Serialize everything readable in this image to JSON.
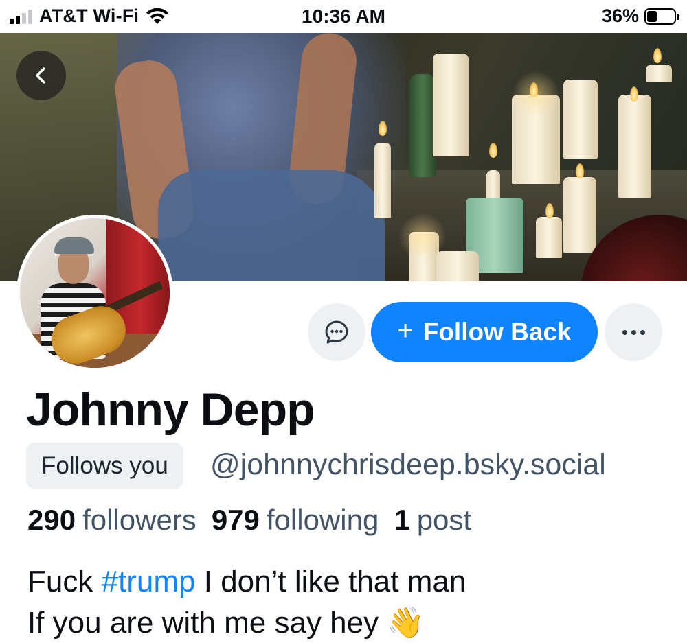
{
  "status_bar": {
    "carrier": "AT&T Wi-Fi",
    "time": "10:36 AM",
    "battery_percent": "36%"
  },
  "profile": {
    "display_name": "Johnny Depp",
    "follows_you_label": "Follows you",
    "handle": "@johnnychrisdeep.bsky.social",
    "followers_count": "290",
    "followers_label": "followers",
    "following_count": "979",
    "following_label": "following",
    "posts_count": "1",
    "posts_label": "post",
    "bio_line1_prefix": "Fuck ",
    "bio_hashtag": "#trump",
    "bio_line1_suffix": " I don’t like that man",
    "bio_line2": "If you are with me say hey",
    "bio_emoji": "👋"
  },
  "actions": {
    "follow_back_label": "Follow Back",
    "follow_plus": "+"
  },
  "colors": {
    "accent": "#1083fe",
    "muted_text": "#425466",
    "button_bg": "#eef1f4"
  },
  "icons": [
    "back-chevron-icon",
    "message-bubble-icon",
    "plus-icon",
    "more-dots-icon",
    "wifi-icon",
    "cellular-signal-icon",
    "battery-icon"
  ]
}
